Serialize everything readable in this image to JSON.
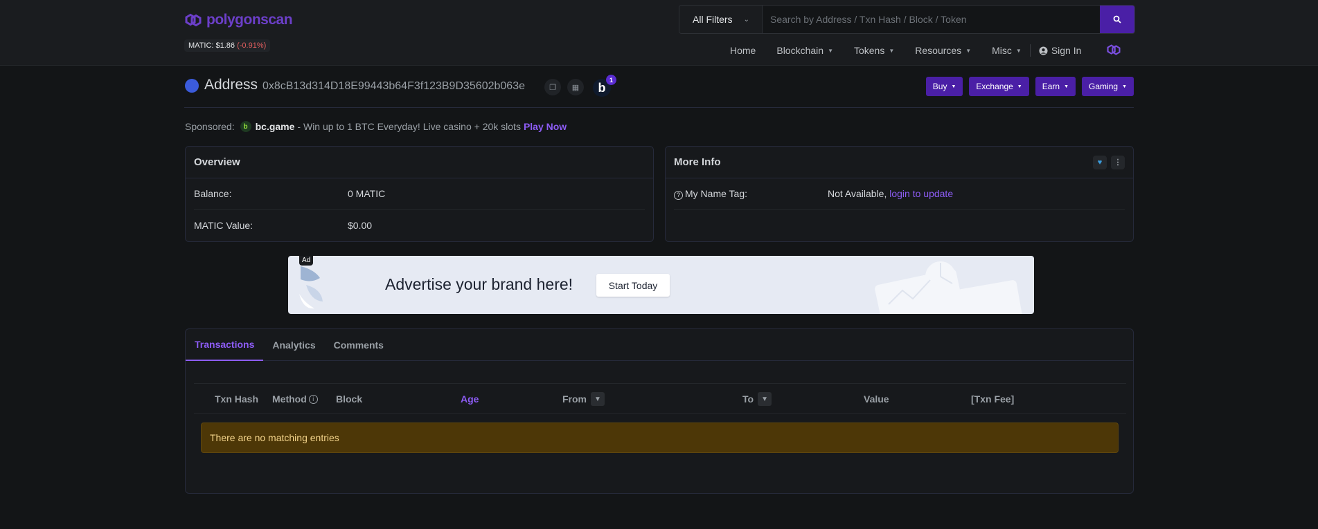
{
  "header": {
    "logo_text": "polygonscan",
    "price_label": "MATIC: $1.86",
    "price_change": "(-0.91%)",
    "filter_label": "All Filters",
    "search_placeholder": "Search by Address / Txn Hash / Block / Token",
    "nav": [
      {
        "label": "Home",
        "has_menu": false
      },
      {
        "label": "Blockchain",
        "has_menu": true
      },
      {
        "label": "Tokens",
        "has_menu": true
      },
      {
        "label": "Resources",
        "has_menu": true
      },
      {
        "label": "Misc",
        "has_menu": true
      }
    ],
    "sign_in": "Sign In"
  },
  "address": {
    "title": "Address",
    "hash": "0x8cB13d314D18E99443b64F3f123B9D35602b063e",
    "badge_letter": "b",
    "badge_count": "1",
    "actions": [
      "Buy",
      "Exchange",
      "Earn",
      "Gaming"
    ]
  },
  "sponsored": {
    "label": "Sponsored:",
    "brand": "bc.game",
    "text": "- Win up to 1 BTC Everyday! Live casino + 20k slots",
    "cta": "Play Now"
  },
  "overview": {
    "title": "Overview",
    "rows": [
      {
        "label": "Balance:",
        "value": "0 MATIC"
      },
      {
        "label": "MATIC Value:",
        "value": "$0.00"
      }
    ]
  },
  "more_info": {
    "title": "More Info",
    "name_tag_label": "My Name Tag:",
    "name_tag_value": "Not Available,",
    "name_tag_link": "login to update"
  },
  "ad": {
    "tag": "Ad",
    "headline": "Advertise your brand here!",
    "button": "Start Today"
  },
  "tabs": [
    "Transactions",
    "Analytics",
    "Comments"
  ],
  "active_tab": "Transactions",
  "table": {
    "columns": [
      "Txn Hash",
      "Method",
      "Block",
      "Age",
      "From",
      "To",
      "Value",
      "[Txn Fee]"
    ],
    "sorted_column": "Age",
    "empty_message": "There are no matching entries"
  },
  "colors": {
    "accent": "#8d5cf5",
    "button_bg": "#4a1fa6",
    "page_bg": "#131517",
    "warning_bg": "#4d3707"
  }
}
